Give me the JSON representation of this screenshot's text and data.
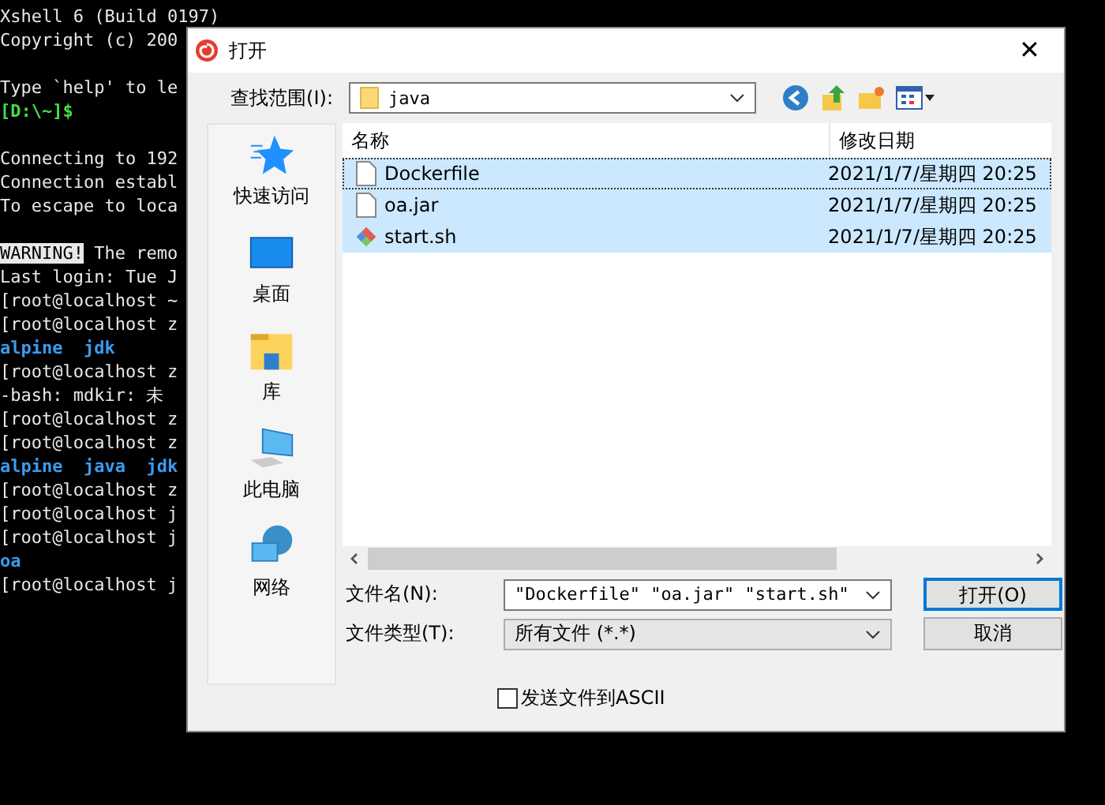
{
  "terminal": {
    "lines": [
      {
        "kind": "plain",
        "text": "Xshell 6 (Build 0197)"
      },
      {
        "kind": "plain",
        "text": "Copyright (c) 200"
      },
      {
        "kind": "blank"
      },
      {
        "kind": "plain",
        "text": "Type `help' to le"
      },
      {
        "kind": "prompt",
        "text": "[D:\\~]$"
      },
      {
        "kind": "blank"
      },
      {
        "kind": "plain",
        "text": "Connecting to 192"
      },
      {
        "kind": "plain",
        "text": "Connection establ"
      },
      {
        "kind": "plain",
        "text": "To escape to loca"
      },
      {
        "kind": "blank"
      },
      {
        "kind": "warning",
        "tag": "WARNING!",
        "text": "The remo"
      },
      {
        "kind": "plain",
        "text": "Last login: Tue J"
      },
      {
        "kind": "plain",
        "text": "[root@localhost ~"
      },
      {
        "kind": "plain",
        "text": "[root@localhost z"
      },
      {
        "kind": "listing",
        "text": "alpine  jdk"
      },
      {
        "kind": "plain",
        "text": "[root@localhost z"
      },
      {
        "kind": "plain",
        "text": "-bash: mdkir: 未"
      },
      {
        "kind": "plain",
        "text": "[root@localhost z"
      },
      {
        "kind": "plain",
        "text": "[root@localhost z"
      },
      {
        "kind": "listing",
        "text": "alpine  java  jdk"
      },
      {
        "kind": "plain",
        "text": "[root@localhost z"
      },
      {
        "kind": "plain",
        "text": "[root@localhost j"
      },
      {
        "kind": "plain",
        "text": "[root@localhost j"
      },
      {
        "kind": "listing",
        "text": "oa"
      },
      {
        "kind": "plain",
        "text": "[root@localhost j"
      }
    ]
  },
  "dialog": {
    "title": "打开",
    "close": "✕",
    "look_in": {
      "label": "查找范围(I):",
      "value": "java"
    },
    "places": [
      {
        "kind": "quick",
        "label": "快速访问"
      },
      {
        "kind": "desktop",
        "label": "桌面"
      },
      {
        "kind": "library",
        "label": "库"
      },
      {
        "kind": "computer",
        "label": "此电脑"
      },
      {
        "kind": "network",
        "label": "网络"
      }
    ],
    "columns": [
      "名称",
      "修改日期"
    ],
    "files": [
      {
        "kind": "doc",
        "name": "Dockerfile",
        "date": "2021/1/7/星期四 20:25",
        "selected": true,
        "focused": true
      },
      {
        "kind": "doc",
        "name": "oa.jar",
        "date": "2021/1/7/星期四 20:25",
        "selected": true,
        "focused": false
      },
      {
        "kind": "script",
        "name": "start.sh",
        "date": "2021/1/7/星期四 20:25",
        "selected": true,
        "focused": false
      }
    ],
    "file_name": {
      "label": "文件名(N):",
      "value": "\"Dockerfile\" \"oa.jar\" \"start.sh\""
    },
    "file_type": {
      "label": "文件类型(T):",
      "value": "所有文件 (*.*)"
    },
    "buttons": [
      {
        "label": "打开(O)",
        "default": true
      },
      {
        "label": "取消",
        "default": false
      }
    ],
    "ascii": {
      "label": "发送文件到ASCII",
      "checked": false
    }
  }
}
